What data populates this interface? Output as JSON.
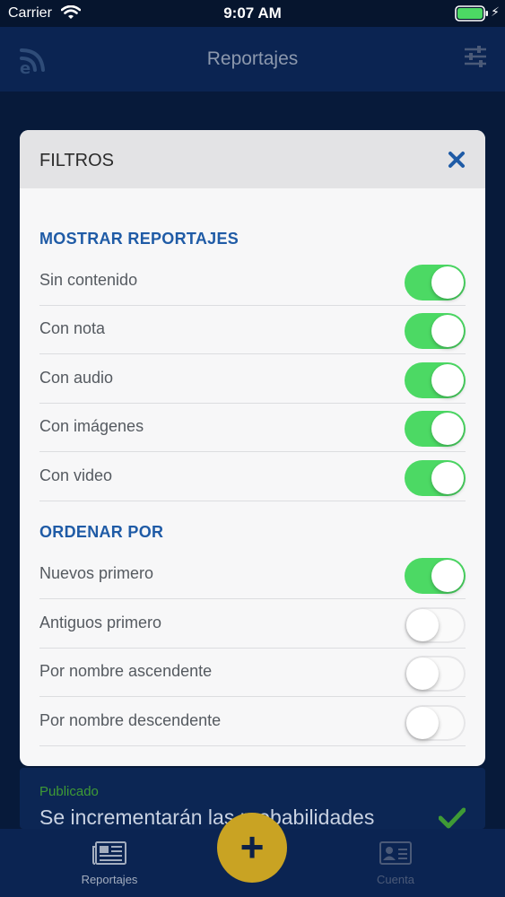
{
  "status_bar": {
    "carrier": "Carrier",
    "time": "9:07 AM",
    "battery_icon": "battery-full-icon",
    "wifi_icon": "wifi-icon"
  },
  "nav": {
    "title": "Reportajes",
    "logo_icon": "app-logo-icon",
    "filter_icon": "sliders-icon"
  },
  "modal": {
    "title": "FILTROS",
    "close_icon": "close-icon",
    "show_section": {
      "heading": "MOSTRAR REPORTAJES",
      "items": [
        {
          "label": "Sin contenido",
          "on": true
        },
        {
          "label": "Con nota",
          "on": true
        },
        {
          "label": "Con audio",
          "on": true
        },
        {
          "label": "Con imágenes",
          "on": true
        },
        {
          "label": "Con video",
          "on": true
        }
      ]
    },
    "order_section": {
      "heading": "ORDENAR POR",
      "items": [
        {
          "label": "Nuevos primero",
          "on": true
        },
        {
          "label": "Antiguos primero",
          "on": false
        },
        {
          "label": "Por nombre ascendente",
          "on": false
        },
        {
          "label": "Por nombre descendente",
          "on": false
        }
      ]
    }
  },
  "background_card": {
    "status": "Publicado",
    "title": "Se incrementarán las probabilidades"
  },
  "tab_bar": {
    "reportajes_label": "Reportajes",
    "cuenta_label": "Cuenta",
    "add_label": "+"
  },
  "colors": {
    "accent": "#1f5ba6",
    "toggle_on": "#4cd964",
    "fab": "#c9a323",
    "nav_bg": "#0b2452"
  }
}
